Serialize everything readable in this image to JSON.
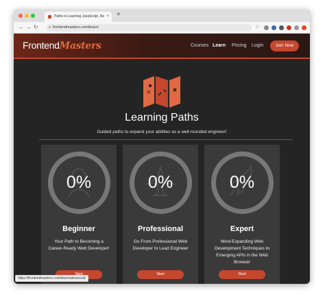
{
  "browser": {
    "tab_title": "Paths to Learning JavaScript, Re",
    "tab_close": "×",
    "new_tab": "+",
    "url": "frontendmasters.com/learn/",
    "status_url": "https://frontendmasters.com/learn/advanced/"
  },
  "header": {
    "logo_part1": "Frontend",
    "logo_part2": "Masters",
    "nav": [
      "Courses",
      "Learn",
      "Pricing",
      "Login"
    ],
    "active_nav": "Learn",
    "join_label": "Join Now"
  },
  "page": {
    "title": "Learning Paths",
    "subtitle": "Guided paths to expand your abilities as a well-rounded engineer!"
  },
  "cards": [
    {
      "percent": "0%",
      "title": "Beginner",
      "description": "Your Path to Becoming a Career-Ready Web Developer!",
      "button": "Start",
      "icon": "person-icon"
    },
    {
      "percent": "0%",
      "title": "Professional",
      "description": "Go From Professional Web Developer to Lead Engineer",
      "button": "Start",
      "icon": "airplane-icon"
    },
    {
      "percent": "0%",
      "title": "Expert",
      "description": "Mind-Expanding Web Development Techniques to Emerging APIs in the Web Browser",
      "button": "Start",
      "icon": "rocket-icon"
    }
  ],
  "colors": {
    "brand": "#c4472e",
    "background": "#242424",
    "card": "#3a3a3a",
    "ring": "#777777"
  }
}
